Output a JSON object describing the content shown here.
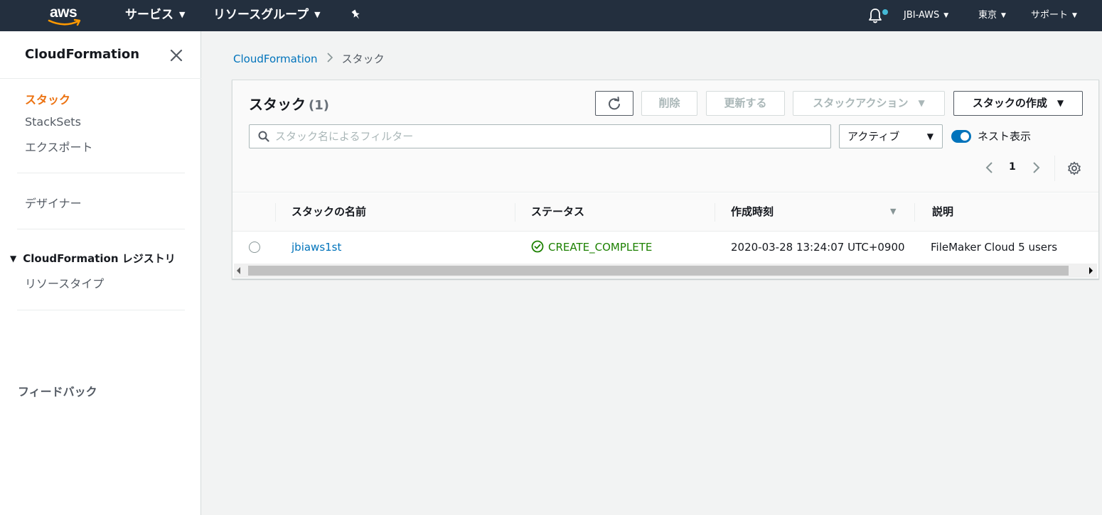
{
  "topnav": {
    "logo": "aws",
    "services": "サービス",
    "resource_groups": "リソースグループ",
    "account": "JBI-AWS",
    "region": "東京",
    "support": "サポート"
  },
  "sidebar": {
    "title": "CloudFormation",
    "items": [
      {
        "label": "スタック",
        "active": true
      },
      {
        "label": "StackSets"
      },
      {
        "label": "エクスポート"
      },
      {
        "label": "デザイナー"
      }
    ],
    "registry_section": "CloudFormation レジストリ",
    "registry_items": [
      {
        "label": "リソースタイプ"
      }
    ],
    "feedback": "フィードバック"
  },
  "breadcrumb": {
    "root": "CloudFormation",
    "current": "スタック"
  },
  "stacks": {
    "title": "スタック",
    "count": "(1)",
    "buttons": {
      "delete": "削除",
      "update": "更新する",
      "stack_actions": "スタックアクション",
      "create_stack": "スタックの作成"
    },
    "search_placeholder": "スタック名によるフィルター",
    "filter_selected": "アクティブ",
    "nested_toggle_label": "ネスト表示",
    "nested_toggle_on": true,
    "page": "1",
    "columns": [
      "スタックの名前",
      "ステータス",
      "作成時刻",
      "説明"
    ],
    "rows": [
      {
        "name": "jbiaws1st",
        "status": "CREATE_COMPLETE",
        "created": "2020-03-28 13:24:07 UTC+0900",
        "description": "FileMaker Cloud 5 users"
      }
    ]
  },
  "colors": {
    "nav_bg": "#232f3e",
    "accent": "#ec7211",
    "link": "#0073bb",
    "success": "#1d8102"
  }
}
